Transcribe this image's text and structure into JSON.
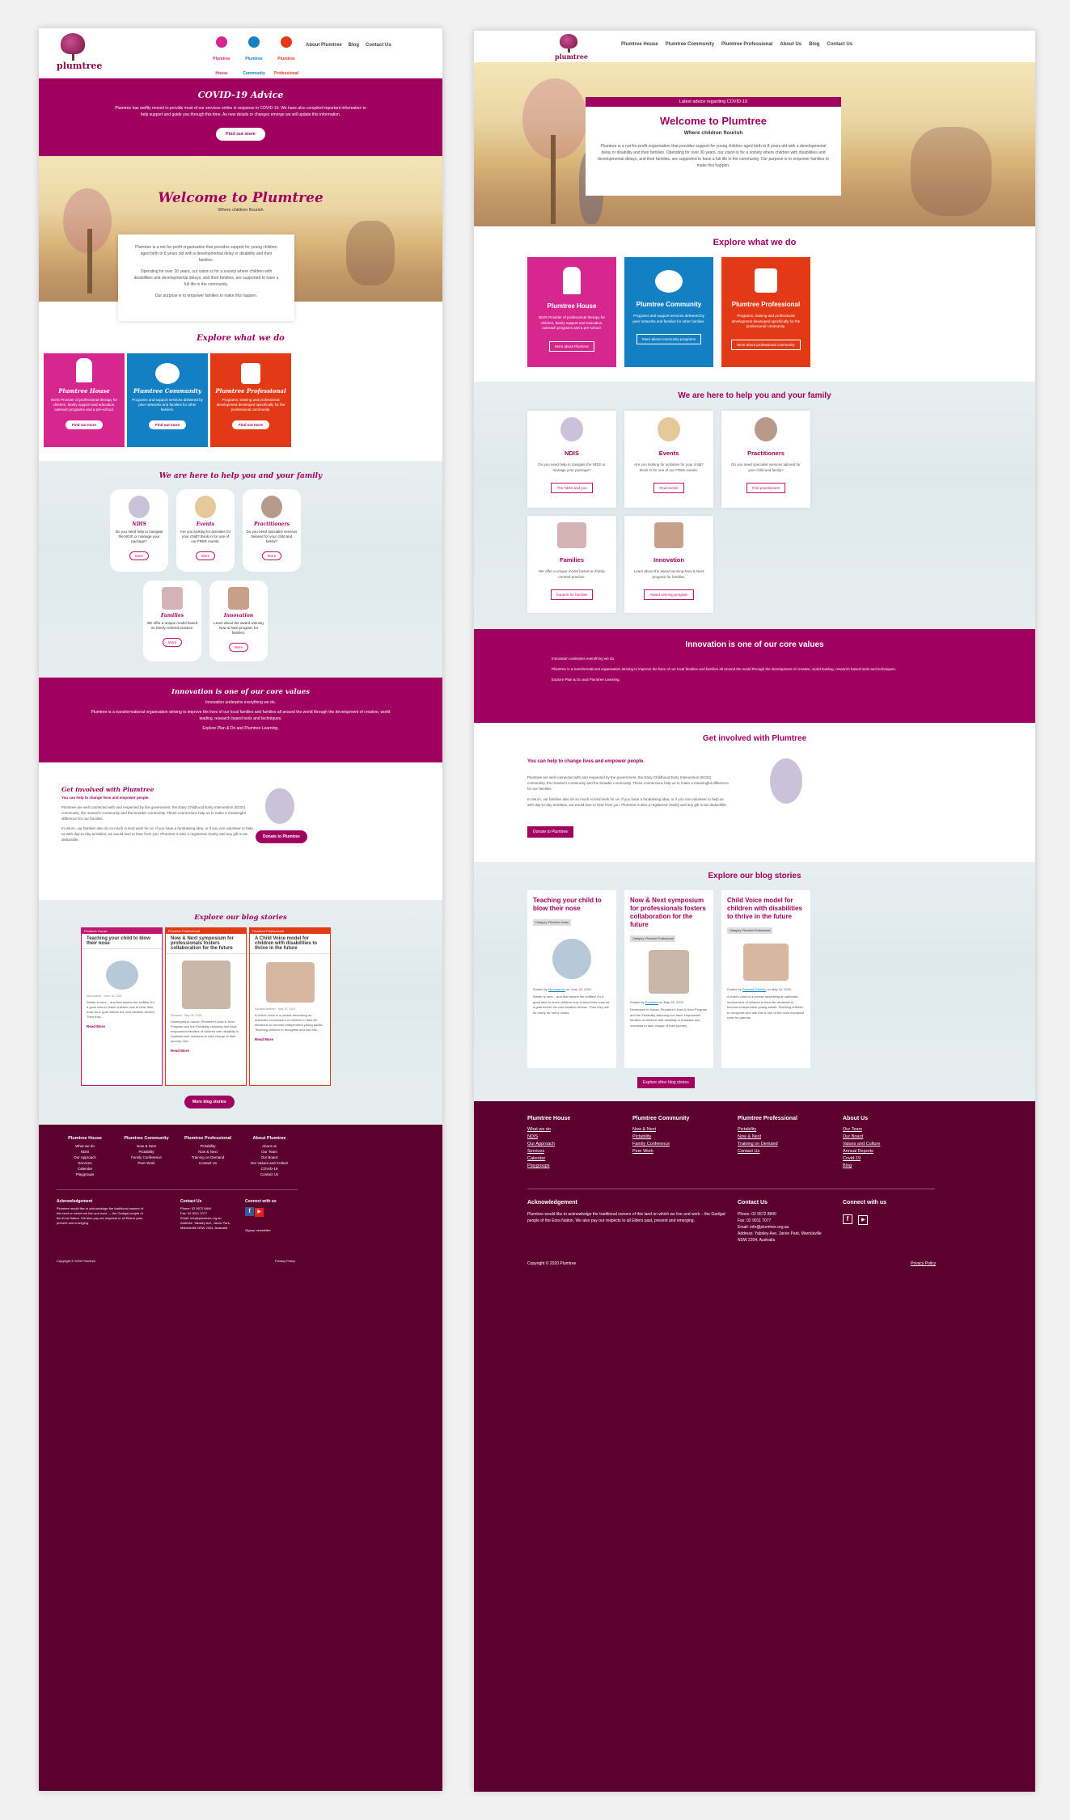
{
  "left": {
    "logo": "plumtree",
    "nav": [
      "Plumtree House",
      "Plumtree Community",
      "Plumtree Professional",
      "About Plumtree",
      "Blog",
      "Contact Us"
    ],
    "covid": {
      "title": "COVID-19 Advice",
      "text": "Plumtree has swiftly moved to provide most of our services online in response to COVID-19. We have also compiled important information to help support and guide you through this time. As new details or changes emerge we will update this information.",
      "button": "Find out more"
    },
    "hero": {
      "title": "Welcome to Plumtree",
      "subtitle": "Where children flourish",
      "p1": "Plumtree is a not-for-profit organisation that provides support for young children aged birth to 8 years old with a developmental delay or disability and their families.",
      "p2": "Operating for over 30 years, our vision is for a society where children with disabilities and developmental delays, and their families, are supported to have a full life in the community.",
      "p3": "Our purpose is to empower families to make this happen."
    },
    "explore": {
      "title": "Explore what we do",
      "cards": [
        {
          "title": "Plumtree House",
          "text": "NDIS Provider of professional therapy for children, family support and education, outreach programs and a pre-school.",
          "button": "Find out more",
          "color": "#d6278e"
        },
        {
          "title": "Plumtree Community",
          "text": "Programs and support services delivered by peer networks and families for other families.",
          "button": "Find out more",
          "color": "#1480c4"
        },
        {
          "title": "Plumtree Professional",
          "text": "Programs, training and professional development developed specifically for the professional community.",
          "button": "Find out more",
          "color": "#e23a17"
        }
      ]
    },
    "help": {
      "title": "We are here to help you and your family",
      "items": [
        {
          "title": "NDIS",
          "text": "Do you need help to navigate the NDIS or manage your package?",
          "button": "More"
        },
        {
          "title": "Events",
          "text": "Are you looking for activities for your child? Book in for one of our FREE events.",
          "button": "More"
        },
        {
          "title": "Practitioners",
          "text": "Do you need specialist services tailored for your child and family?",
          "button": "More"
        },
        {
          "title": "Families",
          "text": "We offer a unique model based on family centred practice.",
          "button": "More"
        },
        {
          "title": "Innovation",
          "text": "Learn about the award winning Now & Next program for families.",
          "button": "More"
        }
      ]
    },
    "innovation": {
      "title": "Innovation is one of our core values",
      "p1": "Innovation underpins everything we do.",
      "p2": "Plumtree is a transformational organisation striving to improve the lives of our local families and families all around the world through the development of creative, world leading, research based tools and techniques.",
      "p3": "Explore Plan & Do and Plumtree Learning."
    },
    "involved": {
      "title": "Get involved with Plumtree",
      "sub": "You can help to change lives and empower people.",
      "p1": "Plumtree are well connected with and respected by the government, the Early Childhood Early Intervention (ECEI) community, the research community and the broader community. These connections help us to make a meaningful difference for our families.",
      "p2": "In return, our families also do so much in kind work for us. If you have a fundraising idea, or if you can volunteer to help us with day-to-day activities, we would love to hear from you. Plumtree is also a registered charity and any gift is tax deductible.",
      "button": "Donate to Plumtree"
    },
    "blog": {
      "title": "Explore our blog stories",
      "posts": [
        {
          "cat": "Plumtree House",
          "title": "Teaching your child to blow their nose",
          "author": "Manuadmin",
          "date": "June 18, 2020",
          "text": "Winter is here... and that means the sniffles! It's a good idea to teach children how to blow their nose as a 'goal' before the cold weather arrives. Then they...",
          "more": "Read More",
          "color": "#c0166e"
        },
        {
          "cat": "Plumtree Professional",
          "title": "Now & Next symposium for professionals fosters collaboration for the future",
          "author": "Plumtree",
          "date": "May 28, 2020",
          "text": "Developed in-house, Plumtree's Now & Next Program and the Pictability visioning tool have empowered families of children with disability in Australia and overseas to take charge of their journey. Our...",
          "more": "Read More",
          "color": "#e23a17"
        },
        {
          "cat": "Plumtree Professional",
          "title": "A Child Voice model for children with disabilities to thrive in the future",
          "author": "Sylvana Mahmic",
          "date": "May 20, 2020",
          "text": "A child's voice is a phrase describing an authentic involvement of children in their life decisions to become independent young adults. Teaching children to recognise and use this...",
          "more": "Read More",
          "color": "#e23a17"
        }
      ],
      "button": "More blog stories"
    },
    "footer": {
      "cols": [
        {
          "title": "Plumtree House",
          "links": [
            "What we do",
            "NDIS",
            "Our Approach",
            "Services",
            "Calendar",
            "Playgroups"
          ]
        },
        {
          "title": "Plumtree Community",
          "links": [
            "Now & Next",
            "Pictability",
            "Family Conference",
            "Peer Work"
          ]
        },
        {
          "title": "Plumtree Professional",
          "links": [
            "Pictability",
            "Now & Next",
            "Training on Demand",
            "Contact Us"
          ]
        },
        {
          "title": "About Plumtree",
          "links": [
            "About us",
            "Our Team",
            "Our Board",
            "Our Values and Culture",
            "COVID-19",
            "Contact Us"
          ]
        }
      ],
      "ack_title": "Acknowledgement",
      "ack": "Plumtree would like to acknowledge the traditional owners of this land on which we live and work — the Gadigal people of the Eora Nation. We also pay our respects to all Elders past, present and emerging.",
      "contact_title": "Contact Us",
      "phone": "Phone: 02 9572 8840",
      "fax": "Fax: 02 9011 7077",
      "email": "Email: info@plumtree.org.au",
      "address": "Address: Yabsley Ave, Jarvie Park, Marrickville NSW 2204, Australia",
      "connect_title": "Connect with us",
      "newsletter": "Signup newsletter",
      "copyright": "Copyright © 2020 Plumtree",
      "privacy": "Privacy Policy"
    }
  },
  "right": {
    "logo": "plumtree",
    "nav": [
      "Plumtree House",
      "Plumtree Community",
      "Plumtree Professional",
      "About Us",
      "Blog",
      "Contact Us"
    ],
    "hero": {
      "banner": "Latest advice regarding COVID-19",
      "title": "Welcome to Plumtree",
      "subtitle": "Where children flourish",
      "text": "Plumtree is a not-for-profit organisation that provides support for young children aged birth to 8 years old with a developmental delay or disability and their families. Operating for over 30 years, our vision is for a society where children with disabilities and developmental delays, and their families, are supported to have a full life in the community. Our purpose is to empower families to make this happen."
    },
    "explore": {
      "title": "Explore what we do",
      "cards": [
        {
          "title": "Plumtree House",
          "text": "NDIS Provider of professional therapy for children, family support and education, outreach programs and a pre-school.",
          "button": "More about Plumtree",
          "color": "#d6278e"
        },
        {
          "title": "Plumtree Community",
          "text": "Programs and support services delivered by peer networks and families for other families.",
          "button": "More about community programs",
          "color": "#1480c4"
        },
        {
          "title": "Plumtree Professional",
          "text": "Programs, training and professional development developed specifically for the professional community.",
          "button": "More about professional community",
          "color": "#e23a17"
        }
      ]
    },
    "help": {
      "title": "We are here to help you and your family",
      "items": [
        {
          "title": "NDIS",
          "text": "Do you need help to navigate the NDIS or manage your package?",
          "button": "The NDIS and you"
        },
        {
          "title": "Events",
          "text": "Are you looking for activities for your child? Book in for one of our FREE events.",
          "button": "Find events"
        },
        {
          "title": "Practitioners",
          "text": "Do you need specialist services tailored for your child and family?",
          "button": "Find practitioners"
        },
        {
          "title": "Families",
          "text": "We offer a unique model based on family centred practice.",
          "button": "Support for families"
        },
        {
          "title": "Innovation",
          "text": "Learn about the award winning Now & Next program for families.",
          "button": "Award winning program"
        }
      ]
    },
    "innovation": {
      "title": "Innovation is one of our core values",
      "p1": "Innovation underpins everything we do.",
      "p2": "Plumtree is a transformational organisation striving to improve the lives of our local families and families all around the world through the development of creative, world leading, research based tools and techniques.",
      "p3": "Explore Plan & Do and Plumtree Learning."
    },
    "involved": {
      "title": "Get involved with Plumtree",
      "sub": "You can help to change lives and empower people.",
      "p1": "Plumtree are well connected with and respected by the government, the Early Childhood Early Intervention (ECEI) community, the research community and the broader community. These connections help us to make a meaningful difference for our families.",
      "p2": "In return, our families also do so much in kind work for us. If you have a fundraising idea, or if you can volunteer to help us with day-to-day activities, we would love to hear from you. Plumtree is also a registered charity and any gift is tax deductible.",
      "button": "Donate to Plumtree"
    },
    "blog": {
      "title": "Explore our blog stories",
      "posts": [
        {
          "title": "Teaching your child to blow their nose",
          "cat": "Category: Plumtree House",
          "posted": "Posted by",
          "author": "Manuadmin",
          "date": "on June 18, 2020",
          "text": "Winter is here... and that means the sniffles! It's a good idea to teach children how to blow their nose as a goal before the cold weather arrives. Then they will be ready for runny noses."
        },
        {
          "title": "Now & Next symposium for professionals fosters collaboration for the future",
          "cat": "Category: Plumtree Professional",
          "posted": "Posted by",
          "author": "Plumtree",
          "date": "on May 28, 2020",
          "text": "Developed in-house, Plumtree's Now & Next Program and the Pictability visioning tool have empowered families of children with disability in Australia and overseas to take charge of their journey."
        },
        {
          "title": "Child Voice model for children with disabilities to thrive in the future",
          "cat": "Category: Plumtree Professional",
          "posted": "Posted by",
          "author": "Sylvana Mahmic",
          "date": "on May 20, 2020",
          "text": "A child's voice is a phrase describing an authentic involvement of children in their life decisions to become independent young adults. Teaching children to recognise and use this is one of the most important roles for parents."
        }
      ],
      "button": "Explore other blog stories"
    },
    "footer": {
      "cols": [
        {
          "title": "Plumtree House",
          "links": [
            "What we do",
            "NDIS",
            "Our Approach",
            "Services",
            "Calendar",
            "Playgroups"
          ]
        },
        {
          "title": "Plumtree Community",
          "links": [
            "Now & Next",
            "Pictability",
            "Family Conference",
            "Peer Work"
          ]
        },
        {
          "title": "Plumtree Professional",
          "links": [
            "Pictability",
            "Now & Next",
            "Training on Demand",
            "Contact Us"
          ]
        },
        {
          "title": "About Us",
          "links": [
            "Our Team",
            "Our Board",
            "Values and Culture",
            "Annual Reports",
            "Covid-19",
            "Blog"
          ]
        }
      ],
      "ack_title": "Acknowledgement",
      "ack": "Plumtree would like to acknowledge the traditional owners of this land on which we live and work – the Gadigal people of the Eora Nation. We also pay our respects to all Elders past, present and emerging.",
      "contact_title": "Contact Us",
      "phone": "Phone: 02 9572 8840",
      "fax": "Fax: 02 9011 7077",
      "email": "Email: info@plumtree.org.au",
      "address": "Address: Yabsley Ave, Jarvie Park, Marrickville NSW 2204, Australia",
      "connect_title": "Connect with us",
      "copyright": "Copyright © 2020 Plumtree",
      "privacy": "Privacy Policy"
    }
  }
}
